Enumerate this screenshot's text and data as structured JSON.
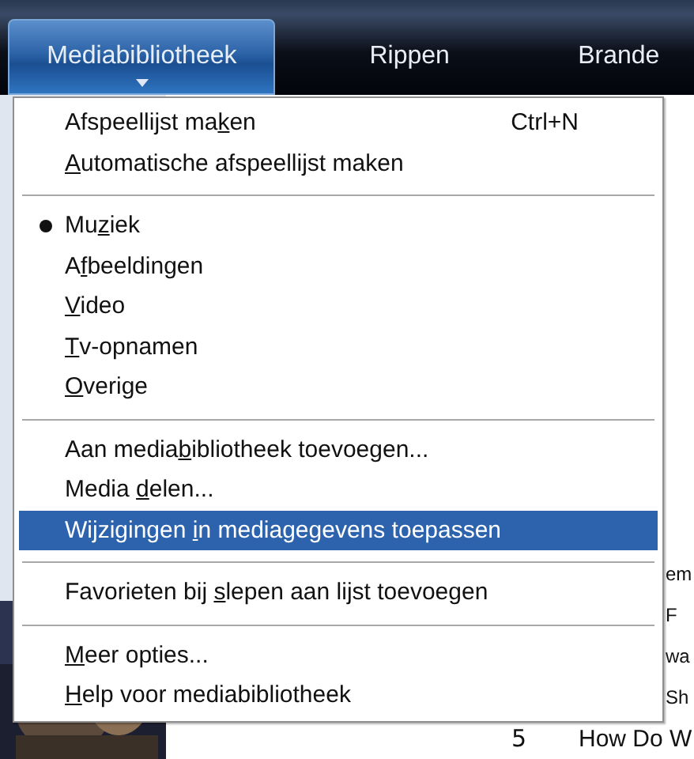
{
  "tabs": [
    {
      "label": "Mediabibliotheek",
      "selected": true
    },
    {
      "label": "Rippen",
      "selected": false
    },
    {
      "label": "Brande",
      "selected": false
    }
  ],
  "track_rows": [
    {
      "title": "em"
    },
    {
      "title": "F"
    },
    {
      "title": "wa"
    },
    {
      "title": "Sh"
    },
    {
      "number": "5",
      "title": "How Do W"
    }
  ],
  "menu": {
    "groups": [
      {
        "items": [
          {
            "before": "Afspeellijst ma",
            "key": "k",
            "after": "en",
            "shortcut": "Ctrl+N",
            "checked": false,
            "selected": false
          },
          {
            "key": "A",
            "after": "utomatische afspeellijst maken",
            "checked": false,
            "selected": false
          }
        ]
      },
      {
        "items": [
          {
            "before": "Mu",
            "key": "z",
            "after": "iek",
            "checked": true,
            "selected": false
          },
          {
            "before": "A",
            "key": "f",
            "after": "beeldingen",
            "checked": false,
            "selected": false
          },
          {
            "key": "V",
            "after": "ideo",
            "checked": false,
            "selected": false
          },
          {
            "key": "T",
            "after": "v-opnamen",
            "checked": false,
            "selected": false
          },
          {
            "key": "O",
            "after": "verige",
            "checked": false,
            "selected": false
          }
        ]
      },
      {
        "items": [
          {
            "before": "Aan media",
            "key": "b",
            "after": "ibliotheek toevoegen...",
            "checked": false,
            "selected": false
          },
          {
            "before": "Media ",
            "key": "d",
            "after": "elen...",
            "checked": false,
            "selected": false
          },
          {
            "before": "Wijzigingen ",
            "key": "i",
            "after": "n mediagegevens toepassen",
            "checked": false,
            "selected": true
          }
        ]
      },
      {
        "items": [
          {
            "before": "Favorieten bij ",
            "key": "s",
            "after": "lepen aan lijst toevoegen",
            "checked": false,
            "selected": false
          }
        ]
      },
      {
        "items": [
          {
            "key": "M",
            "after": "eer opties...",
            "checked": false,
            "selected": false
          },
          {
            "key": "H",
            "after": "elp voor mediabibliotheek",
            "checked": false,
            "selected": false
          }
        ]
      }
    ]
  }
}
